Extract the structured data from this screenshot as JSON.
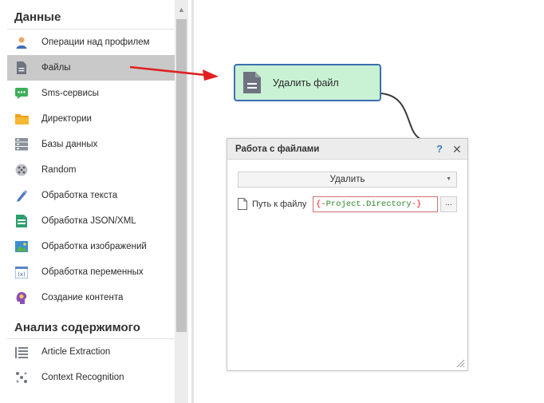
{
  "sidebar": {
    "sections": [
      {
        "title": "Данные",
        "items": [
          {
            "label": "Операции над профилем",
            "icon": "user-icon"
          },
          {
            "label": "Файлы",
            "icon": "file-icon",
            "selected": true
          },
          {
            "label": "Sms-сервисы",
            "icon": "sms-icon"
          },
          {
            "label": "Директории",
            "icon": "folder-icon"
          },
          {
            "label": "Базы данных",
            "icon": "database-icon"
          },
          {
            "label": "Random",
            "icon": "dice-icon"
          },
          {
            "label": "Обработка текста",
            "icon": "pen-icon"
          },
          {
            "label": "Обработка JSON/XML",
            "icon": "json-icon"
          },
          {
            "label": "Обработка изображений",
            "icon": "image-icon"
          },
          {
            "label": "Обработка переменных",
            "icon": "variable-icon"
          },
          {
            "label": "Создание контента",
            "icon": "brain-icon"
          }
        ]
      },
      {
        "title": "Анализ содержимого",
        "items": [
          {
            "label": "Article Extraction",
            "icon": "article-icon"
          },
          {
            "label": "Context Recognition",
            "icon": "context-icon"
          }
        ]
      }
    ]
  },
  "node": {
    "label": "Удалить файл",
    "icon": "file-icon"
  },
  "panel": {
    "title": "Работа с файлами",
    "help": "?",
    "close": "✕",
    "action_select": "Удалить",
    "path_label": "Путь к файлу",
    "path_value": {
      "open": "{-",
      "variable": "Project.Directory",
      "close": "-}"
    },
    "browse_button": "..."
  },
  "colors": {
    "node_fill": "#c9f1d4",
    "node_border": "#3c6fb0",
    "selected_item": "#c9c9c9",
    "arrow": "#e02020",
    "help_icon": "#3b7cc4"
  }
}
